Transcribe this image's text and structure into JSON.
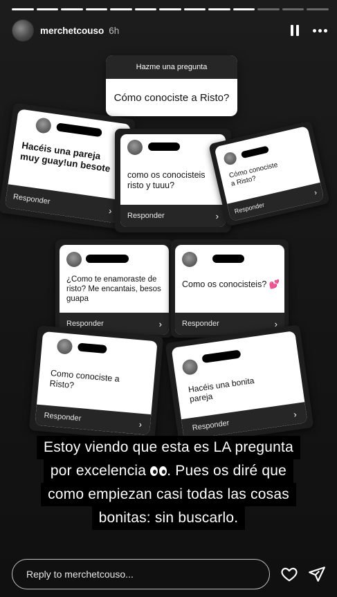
{
  "story": {
    "username": "merchetcouso",
    "time": "6h",
    "segments": 13,
    "current_segment": 10
  },
  "question": {
    "header": "Hazme una pregunta",
    "text": "Cómo conociste a Risto?"
  },
  "answers": [
    {
      "text": "Hacéis una pareja muy guay!un besote",
      "reply": "Responder"
    },
    {
      "text": "como os conocisteis risto y tuuu?",
      "reply": "Responder"
    },
    {
      "text": "Cómo conociste a Risto?",
      "reply": "Responder"
    },
    {
      "text": "¿Como te enamoraste de risto? Me encantais, besos guapa",
      "reply": "Responder"
    },
    {
      "text": "Como os conocisteis? 💕",
      "reply": "Responder"
    },
    {
      "text": "Como conociste a Risto?",
      "reply": "Responder"
    },
    {
      "text": "Hacéis una bonita pareja",
      "reply": "Responder"
    }
  ],
  "caption": {
    "line1": "Estoy viendo que esta es LA pregunta",
    "line2a": "por excelencia",
    "line2b": ". Pues os diré que",
    "line3": "como empiezan casi todas las cosas",
    "line4": "bonitas: sin buscarlo."
  },
  "footer": {
    "reply_placeholder": "Reply to merchetcouso..."
  },
  "icons": {
    "pause": "pause-icon",
    "more": "more-icon",
    "like": "heart-icon",
    "share": "send-icon",
    "caption_emoji": "eyes-emoji"
  }
}
